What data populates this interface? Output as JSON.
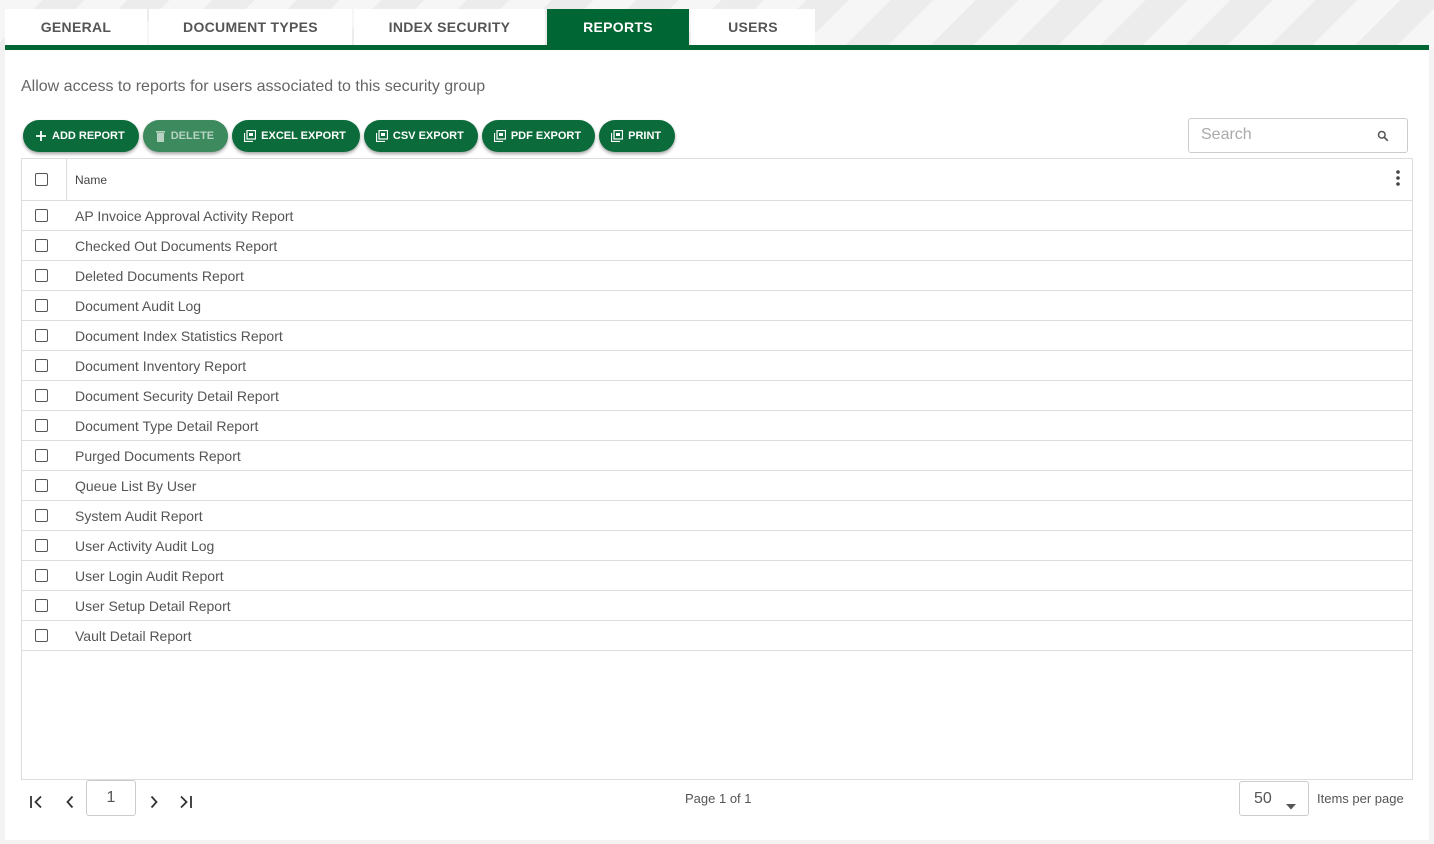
{
  "tabs": [
    {
      "label": "GENERAL",
      "active": false
    },
    {
      "label": "DOCUMENT TYPES",
      "active": false
    },
    {
      "label": "INDEX SECURITY",
      "active": false
    },
    {
      "label": "REPORTS",
      "active": true
    },
    {
      "label": "USERS",
      "active": false
    }
  ],
  "description": "Allow access to reports for users associated to this security group",
  "toolbar": {
    "add_label": "ADD REPORT",
    "delete_label": "DELETE",
    "excel_label": "EXCEL EXPORT",
    "csv_label": "CSV EXPORT",
    "pdf_label": "PDF EXPORT",
    "print_label": "PRINT"
  },
  "search": {
    "placeholder": "Search"
  },
  "grid": {
    "column_name": "Name",
    "rows": [
      "AP Invoice Approval Activity Report",
      "Checked Out Documents Report",
      "Deleted Documents Report",
      "Document Audit Log",
      "Document Index Statistics Report",
      "Document Inventory Report",
      "Document Security Detail Report",
      "Document Type Detail Report",
      "Purged Documents Report",
      "Queue List By User",
      "System Audit Report",
      "User Activity Audit Log",
      "User Login Audit Report",
      "User Setup Detail Report",
      "Vault Detail Report"
    ]
  },
  "pager": {
    "page_value": "1",
    "page_info": "Page 1 of 1",
    "items_per_page": "50",
    "items_per_page_label": "Items per page"
  },
  "colors": {
    "brand": "#006633",
    "button": "#0b6b3a"
  }
}
